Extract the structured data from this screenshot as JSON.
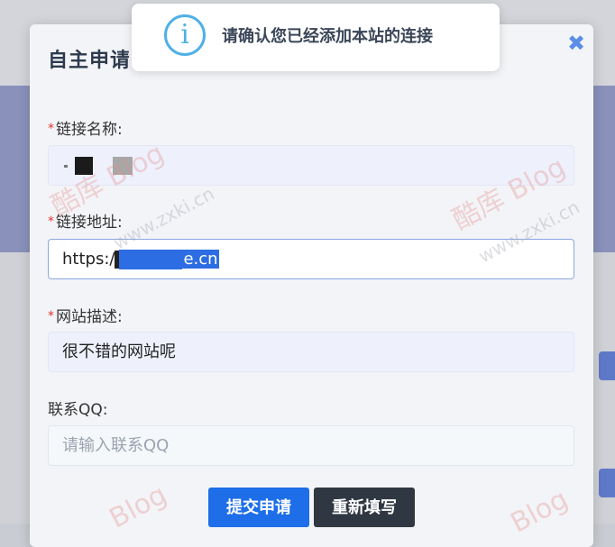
{
  "modal": {
    "title": "自主申请",
    "close_symbol": "✖"
  },
  "fields": {
    "link_name": {
      "label": "链接名称:",
      "required_mark": "*",
      "value": ""
    },
    "link_url": {
      "label": "链接地址:",
      "required_mark": "*",
      "value_prefix": "https:/",
      "value_suffix": "e.cn"
    },
    "site_desc": {
      "label": "网站描述:",
      "required_mark": "*",
      "value": "很不错的网站呢"
    },
    "contact_qq": {
      "label": "联系QQ:",
      "placeholder": "请输入联系QQ"
    }
  },
  "buttons": {
    "submit": "提交申请",
    "reset": "重新填写"
  },
  "toast": {
    "icon": "info-icon",
    "icon_glyph": "i",
    "message": "请确认您已经添加本站的连接"
  },
  "watermarks": {
    "brand": "酷库 Blog",
    "domain": "www.zxki.cn",
    "blog": "Blog"
  },
  "colors": {
    "primary": "#1d6ee8",
    "secondary": "#2f3742",
    "required": "#e0362c",
    "info": "#4fb0e6"
  }
}
